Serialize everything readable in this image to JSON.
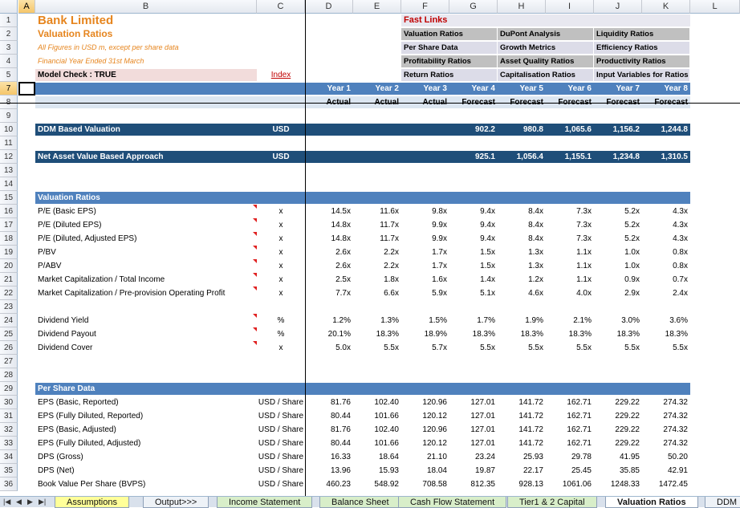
{
  "columns": [
    "A",
    "B",
    "C",
    "D",
    "E",
    "F",
    "G",
    "H",
    "I",
    "J",
    "K",
    "L"
  ],
  "selected_col": "A",
  "selected_row": 7,
  "rows": [
    1,
    2,
    3,
    4,
    5,
    7,
    8,
    9,
    10,
    11,
    12,
    13,
    14,
    15,
    16,
    17,
    18,
    19,
    20,
    21,
    22,
    23,
    24,
    25,
    26,
    27,
    28,
    29,
    30,
    31,
    32,
    33,
    34,
    35,
    36
  ],
  "header": {
    "company": "Bank Limited",
    "title": "Valuation Ratios",
    "note1": "All Figures in USD m, except per share data",
    "note2": "Financial Year Ended 31st March",
    "model_check": "Model Check : TRUE",
    "index_link": "Index"
  },
  "fast_links": {
    "title": "Fast Links",
    "items": [
      "Valuation Ratios",
      "DuPont Analysis",
      "Liquidity Ratios",
      "Per Share Data",
      "Growth Metrics",
      "Efficiency Ratios",
      "Profitability Ratios",
      "Asset Quality Ratios",
      "Productivity Ratios",
      "Return Ratios",
      "Capitalisation Ratios",
      "Input Variables for Ratios"
    ]
  },
  "years": [
    "Year 1",
    "Year 2",
    "Year 3",
    "Year 4",
    "Year 5",
    "Year 6",
    "Year 7",
    "Year 8"
  ],
  "types": [
    "Actual",
    "Actual",
    "Actual",
    "Forecast",
    "Forecast",
    "Forecast",
    "Forecast",
    "Forecast"
  ],
  "ddm": {
    "label": "DDM Based Valuation",
    "unit": "USD",
    "values": [
      "",
      "",
      "",
      "902.2",
      "980.8",
      "1,065.6",
      "1,156.2",
      "1,244.8"
    ]
  },
  "nav": {
    "label": "Net Asset Value Based Approach",
    "unit": "USD",
    "values": [
      "",
      "",
      "",
      "925.1",
      "1,056.4",
      "1,155.1",
      "1,234.8",
      "1,310.5"
    ]
  },
  "valuation_section": "Valuation Ratios",
  "valuation_rows": [
    {
      "label": "P/E (Basic EPS)",
      "unit": "x",
      "values": [
        "14.5x",
        "11.6x",
        "9.8x",
        "9.4x",
        "8.4x",
        "7.3x",
        "5.2x",
        "4.3x"
      ]
    },
    {
      "label": "P/E (Diluted EPS)",
      "unit": "x",
      "values": [
        "14.8x",
        "11.7x",
        "9.9x",
        "9.4x",
        "8.4x",
        "7.3x",
        "5.2x",
        "4.3x"
      ]
    },
    {
      "label": "P/E (Diluted, Adjusted EPS)",
      "unit": "x",
      "values": [
        "14.8x",
        "11.7x",
        "9.9x",
        "9.4x",
        "8.4x",
        "7.3x",
        "5.2x",
        "4.3x"
      ]
    },
    {
      "label": "P/BV",
      "unit": "x",
      "values": [
        "2.6x",
        "2.2x",
        "1.7x",
        "1.5x",
        "1.3x",
        "1.1x",
        "1.0x",
        "0.8x"
      ]
    },
    {
      "label": "P/ABV",
      "unit": "x",
      "values": [
        "2.6x",
        "2.2x",
        "1.7x",
        "1.5x",
        "1.3x",
        "1.1x",
        "1.0x",
        "0.8x"
      ]
    },
    {
      "label": "Market Capitalization / Total Income",
      "unit": "x",
      "values": [
        "2.5x",
        "1.8x",
        "1.6x",
        "1.4x",
        "1.2x",
        "1.1x",
        "0.9x",
        "0.7x"
      ]
    },
    {
      "label": "Market Capitalization / Pre-provision Operating Profit",
      "unit": "x",
      "values": [
        "7.7x",
        "6.6x",
        "5.9x",
        "5.1x",
        "4.6x",
        "4.0x",
        "2.9x",
        "2.4x"
      ]
    }
  ],
  "dividend_rows": [
    {
      "label": "Dividend Yield",
      "unit": "%",
      "values": [
        "1.2%",
        "1.3%",
        "1.5%",
        "1.7%",
        "1.9%",
        "2.1%",
        "3.0%",
        "3.6%"
      ]
    },
    {
      "label": "Dividend Payout",
      "unit": "%",
      "values": [
        "20.1%",
        "18.3%",
        "18.9%",
        "18.3%",
        "18.3%",
        "18.3%",
        "18.3%",
        "18.3%"
      ]
    },
    {
      "label": "Dividend Cover",
      "unit": "x",
      "values": [
        "5.0x",
        "5.5x",
        "5.7x",
        "5.5x",
        "5.5x",
        "5.5x",
        "5.5x",
        "5.5x"
      ]
    }
  ],
  "per_share_section": "Per Share Data",
  "per_share_rows": [
    {
      "label": "EPS (Basic, Reported)",
      "unit": "USD / Share",
      "values": [
        "81.76",
        "102.40",
        "120.96",
        "127.01",
        "141.72",
        "162.71",
        "229.22",
        "274.32"
      ]
    },
    {
      "label": "EPS (Fully Diluted, Reported)",
      "unit": "USD / Share",
      "values": [
        "80.44",
        "101.66",
        "120.12",
        "127.01",
        "141.72",
        "162.71",
        "229.22",
        "274.32"
      ]
    },
    {
      "label": "EPS (Basic, Adjusted)",
      "unit": "USD / Share",
      "values": [
        "81.76",
        "102.40",
        "120.96",
        "127.01",
        "141.72",
        "162.71",
        "229.22",
        "274.32"
      ]
    },
    {
      "label": "EPS (Fully Diluted, Adjusted)",
      "unit": "USD / Share",
      "values": [
        "80.44",
        "101.66",
        "120.12",
        "127.01",
        "141.72",
        "162.71",
        "229.22",
        "274.32"
      ]
    },
    {
      "label": "DPS (Gross)",
      "unit": "USD / Share",
      "values": [
        "16.33",
        "18.64",
        "21.10",
        "23.24",
        "25.93",
        "29.78",
        "41.95",
        "50.20"
      ]
    },
    {
      "label": "DPS (Net)",
      "unit": "USD / Share",
      "values": [
        "13.96",
        "15.93",
        "18.04",
        "19.87",
        "22.17",
        "25.45",
        "35.85",
        "42.91"
      ]
    },
    {
      "label": "Book Value Per Share (BVPS)",
      "unit": "USD / Share",
      "values": [
        "460.23",
        "548.92",
        "708.58",
        "812.35",
        "928.13",
        "1061.06",
        "1248.33",
        "1472.45"
      ]
    }
  ],
  "tabs": [
    "Assumptions",
    "Output>>>",
    "Income Statement",
    "Balance Sheet",
    "Cash Flow Statement",
    "Tier1 & 2 Capital",
    "Valuation Ratios",
    "DDM B"
  ],
  "active_tab": "Valuation Ratios",
  "colors": {
    "title_orange": "#e6851e",
    "section_blue": "#4f81bd",
    "dark_blue": "#1f4e79",
    "link_gray": "#c0c0c0",
    "link_light": "#dcdce8",
    "model_check_bg": "#f2dcdb",
    "year_row_bg": "#dce6f1"
  }
}
